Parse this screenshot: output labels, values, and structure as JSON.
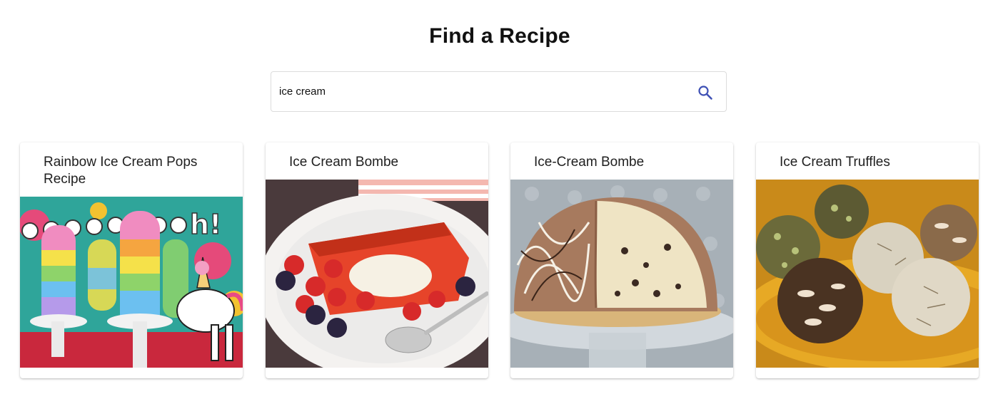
{
  "header": {
    "title": "Find a Recipe"
  },
  "search": {
    "value": "ice cream",
    "icon": "search-icon",
    "accent_color": "#3f51b5"
  },
  "recipes": [
    {
      "title": "Rainbow Ice Cream Pops Recipe",
      "image": "rainbow-ice-cream-pops-photo"
    },
    {
      "title": "Ice Cream Bombe",
      "image": "ice-cream-bombe-with-berries-photo"
    },
    {
      "title": "Ice-Cream Bombe",
      "image": "chocolate-ice-cream-bombe-photo"
    },
    {
      "title": "Ice Cream Truffles",
      "image": "ice-cream-truffles-photo"
    }
  ]
}
